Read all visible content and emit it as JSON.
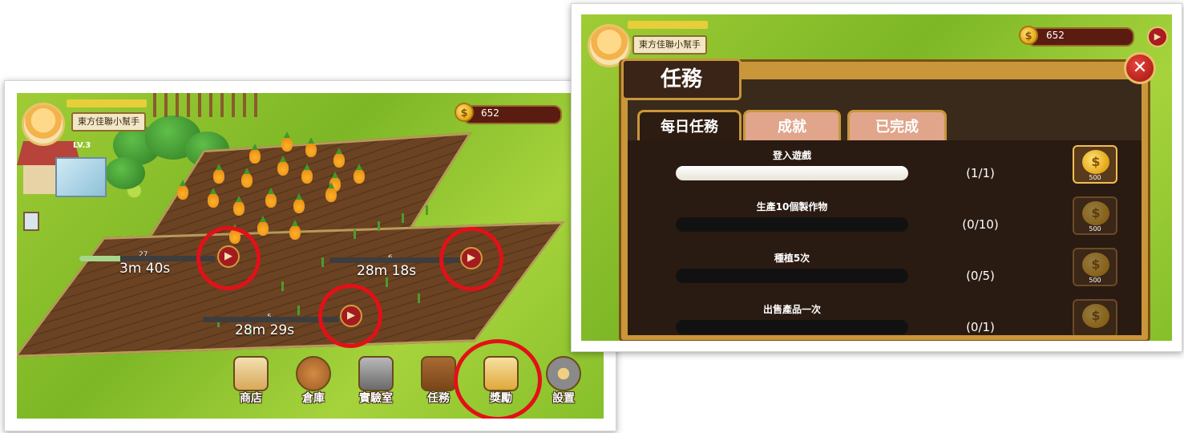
{
  "left_screen": {
    "player": {
      "name": "東方佳聯小幫手",
      "level": "LV.3"
    },
    "coins": "652",
    "plots": [
      {
        "count": "27",
        "timer": "3m 40s",
        "progress": 0.3
      },
      {
        "count": "6",
        "timer": "28m 18s",
        "progress": 0.0
      },
      {
        "count": "5",
        "timer": "28m 29s",
        "progress": 0.0
      }
    ],
    "ad_icon": "tv-play-icon",
    "menu": [
      {
        "label": "商店",
        "icon": "shop-icon"
      },
      {
        "label": "倉庫",
        "icon": "warehouse-bag-icon"
      },
      {
        "label": "實驗室",
        "icon": "lab-icon"
      },
      {
        "label": "任務",
        "icon": "trophy-book-icon"
      },
      {
        "label": "獎勵",
        "icon": "megaphone-reward-icon"
      },
      {
        "label": "設置",
        "icon": "gear-icon"
      }
    ],
    "highlight_color": "#e31018"
  },
  "right_screen": {
    "player": {
      "name": "東方佳聯小幫手"
    },
    "coins": "652",
    "dialog": {
      "title": "任務",
      "close": "✕",
      "tabs": [
        "每日任務",
        "成就",
        "已完成"
      ],
      "active_tab": 0,
      "tasks": [
        {
          "name": "登入遊戲",
          "progress_text": "(1/1)",
          "progress": 1.0,
          "reward": "500",
          "claimable": true
        },
        {
          "name": "生產10個製作物",
          "progress_text": "(0/10)",
          "progress": 0.0,
          "reward": "500",
          "claimable": false
        },
        {
          "name": "種植5次",
          "progress_text": "(0/5)",
          "progress": 0.0,
          "reward": "500",
          "claimable": false
        },
        {
          "name": "出售產品一次",
          "progress_text": "(0/1)",
          "progress": 0.0,
          "reward": "",
          "claimable": false
        }
      ]
    }
  }
}
